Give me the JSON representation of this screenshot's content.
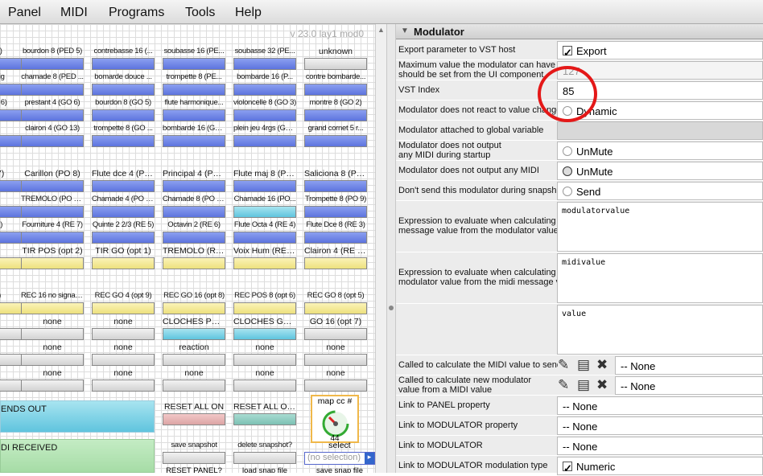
{
  "menu": [
    "Panel",
    "MIDI",
    "Programs",
    "Tools",
    "Help"
  ],
  "canvas": {
    "version": "v 23.0 lay1 mod0",
    "rows": [
      {
        "color": "blue",
        "labels": [
          "e 4)",
          "bourdon 8 (PED 5)",
          "contrebasse 16 (...",
          "soubasse 16 (PE...",
          "soubasse 32 (PE...",
          "unknown"
        ]
      },
      {
        "color": "blue",
        "labels": [
          "gosig",
          "chamade 8 (PED ...",
          "bomarde douce ...",
          "trompette 8 (PE...",
          "bombarde 16 (P...",
          "contre bombarde..."
        ]
      },
      {
        "color": "blue",
        "labels": [
          "(GO 6)",
          "prestant 4 (GO 6)",
          "bourdon 8 (GO 5)",
          "flute harmonique...",
          "violoncelle 8 (GO 3)",
          "montre 8 (GO 2)"
        ]
      },
      {
        "color": "blue",
        "labels": [
          "",
          "clairon 4 (GO 13)",
          "trompette 8 (GO ...",
          "bombarde 16 (GO...",
          "plein jeu 4rgs (GO...",
          "grand cornet 5 r..."
        ]
      },
      {
        "color": "blue",
        "labels": [
          "O 7)",
          "Carillon (PO 8)",
          "Flute dce 4 (PO 6)",
          "Principal 4 (PO 5)",
          "Flute maj 8 (PO 4)",
          "Saliciona 8 (PO 3)"
        ]
      },
      {
        "color": "blue",
        "labels": [
          "",
          "TREMOLO (PO 14)",
          "Chamade 4 (PO 13)",
          "Chamade 8 (PO 12)",
          "Chamade 16 (PO...",
          "Trompette 8 (PO 9)"
        ]
      },
      {
        "color": "blue",
        "labels": [
          "E 8)",
          "Fourniture 4 (RE 7)",
          "Quinte 2 2/3 (RE 5)",
          "Octavin 2 (RE 6)",
          "Flute Octa 4 (RE 4)",
          "Flute Dce 8 (RE 3)"
        ]
      },
      {
        "color": "yellow",
        "labels": [
          "",
          "TIR POS (opt 2)",
          "TIR GO (opt 1)",
          "TREMOLO (RE 12)",
          "Voix Hum (RE 11)",
          "Clairon 4 (RE 10)"
        ]
      },
      {
        "color": "yellow",
        "labels": [
          "11)",
          "REC 16 no signal 10",
          "REC GO 4 (opt 9)",
          "REC GO 16 (opt 8)",
          "REC POS 8 (opt 6)",
          "REC GO 8 (opt 5)"
        ]
      },
      {
        "color": "gray",
        "labels": [
          "",
          "none",
          "none",
          "CLOCHES PO (op...",
          "CLOCHES GO (o...",
          "GO 16 (opt 7)"
        ]
      },
      {
        "color": "gray",
        "labels": [
          "",
          "none",
          "none",
          "reaction",
          "none",
          "none"
        ]
      },
      {
        "color": "gray",
        "labels": [
          "",
          "none",
          "none",
          "none",
          "none",
          "none"
        ]
      }
    ],
    "bottom": {
      "sends_out": "ENDS OUT",
      "reset_all_on": "RESET ALL ON",
      "reset_all_off": "RESET ALL OFF",
      "map_cc": "map cc #",
      "map_value": "44",
      "midi_received": "DI RECEIVED",
      "save_snapshot": "save snapshot",
      "delete_snapshot": "delete snapshot?",
      "select": "select",
      "select_value": "(no selection)",
      "reset_panel": "RESET PANEL?",
      "load_snap": "load snap file",
      "save_snap": "save snap file"
    }
  },
  "panel": {
    "title": "Modulator",
    "rows": [
      {
        "label": "Export parameter to VST host",
        "value": "Export",
        "kind": "check",
        "checked": true
      },
      {
        "label": "Maximum value the modulator can have\nshould be set from the UI component",
        "value": "127",
        "kind": "text-gray"
      },
      {
        "label": "VST Index",
        "value": "85",
        "kind": "text"
      },
      {
        "label": "Modulator does not react to value changes",
        "value": "Dynamic",
        "kind": "radio"
      },
      {
        "label": "Modulator attached to global variable",
        "value": "",
        "kind": "blank"
      },
      {
        "label": "Modulator does not output\nany MIDI during startup",
        "value": "UnMute",
        "kind": "radio"
      },
      {
        "label": "Modulator does not output any MIDI",
        "value": "UnMute",
        "kind": "radio-dark"
      },
      {
        "label": "Don't send this modulator during snapshots",
        "value": "Send",
        "kind": "radio"
      },
      {
        "label": "Expression to evaluate when calculating the midi\nmessage value from the modulator value",
        "value": "modulatorvalue",
        "kind": "code"
      },
      {
        "label": "Expression to evaluate when calculating the\nmodulator value from the midi message value",
        "value": "midivalue",
        "kind": "code"
      },
      {
        "label": "",
        "value": "value",
        "kind": "code"
      },
      {
        "label": "Called to calculate the MIDI value to send",
        "value": "-- None",
        "kind": "func"
      },
      {
        "label": "Called to calculate new modulator\nvalue from a MIDI value",
        "value": "-- None",
        "kind": "func"
      },
      {
        "label": "Link to PANEL property",
        "value": "-- None",
        "kind": "select"
      },
      {
        "label": "Link to MODULATOR property",
        "value": "-- None",
        "kind": "select"
      },
      {
        "label": "Link to MODULATOR",
        "value": "-- None",
        "kind": "select"
      },
      {
        "label": "Link to MODULATOR modulation type",
        "value": "Numeric",
        "kind": "check",
        "checked": true
      }
    ]
  }
}
